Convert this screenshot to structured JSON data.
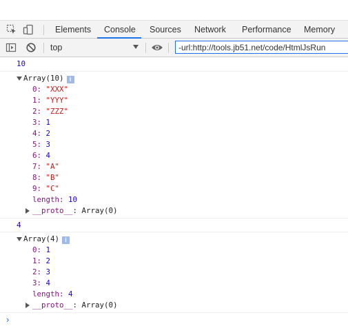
{
  "tabs": [
    {
      "label": "Elements",
      "selected": false
    },
    {
      "label": "Console",
      "selected": true
    },
    {
      "label": "Sources",
      "selected": false
    },
    {
      "label": "Network",
      "selected": false
    },
    {
      "label": "Performance",
      "selected": false
    },
    {
      "label": "Memory",
      "selected": false
    }
  ],
  "toolbar": {
    "context": "top",
    "filter_value": "-url:http://tools.jb51.net/code/HtmlJsRun"
  },
  "console": {
    "msg1": "10",
    "array1": {
      "label": "Array(10)",
      "info": "i",
      "items": [
        {
          "key": "0: ",
          "value": "\"XXX\""
        },
        {
          "key": "1: ",
          "value": "\"YYY\""
        },
        {
          "key": "2: ",
          "value": "\"ZZZ\""
        },
        {
          "key": "3: ",
          "value": "1"
        },
        {
          "key": "4: ",
          "value": "2"
        },
        {
          "key": "5: ",
          "value": "3"
        },
        {
          "key": "6: ",
          "value": "4"
        },
        {
          "key": "7: ",
          "value": "\"A\""
        },
        {
          "key": "8: ",
          "value": "\"B\""
        },
        {
          "key": "9: ",
          "value": "\"C\""
        }
      ],
      "length_key": "length: ",
      "length_value": "10",
      "proto_key": "__proto__",
      "proto_value": ": Array(0)"
    },
    "msg2": "4",
    "array2": {
      "label": "Array(4)",
      "info": "i",
      "items": [
        {
          "key": "0: ",
          "value": "1"
        },
        {
          "key": "1: ",
          "value": "2"
        },
        {
          "key": "2: ",
          "value": "3"
        },
        {
          "key": "3: ",
          "value": "4"
        }
      ],
      "length_key": "length: ",
      "length_value": "4",
      "proto_key": "__proto__",
      "proto_value": ": Array(0)"
    },
    "prompt": "›"
  }
}
